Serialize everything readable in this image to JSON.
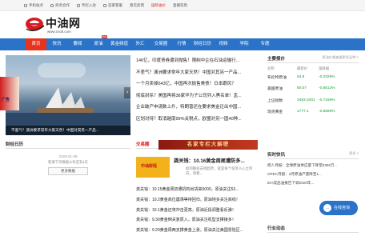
{
  "topbar": [
    "手机站点",
    "商务合作",
    "专栏入驻",
    "首家客服",
    "意见反馈",
    "国际油价",
    "直播签到"
  ],
  "logo": {
    "name": "中油网",
    "url": "www.cnoil.com"
  },
  "nav": {
    "items": [
      "首页",
      "快讯",
      "要闻",
      "原油",
      "黄金频道",
      "外汇",
      "交易圈",
      "行情",
      "财经日历",
      "视频",
      "学院",
      "专题"
    ],
    "hot_label": "Hot"
  },
  "slide": {
    "caption": "不差气？澳洲要求常年大家天然！中国对其另一产品..."
  },
  "left_banner": {
    "text": "广告"
  },
  "news": [
    "146亿，印度债券遭到抛售！限制中企在石油运输行...",
    "不差气？澳洲要求常年大家天然！中国对其另一产品...",
    "一个月卖掉643亿，中国再次抛售美债！日本跟风？",
    "彻底封杀？美国再将38家华为子公司列入黑名单！盂...",
    "企业破产申请数上升，特朗普还在要求美金迁出中国...",
    "区划对待？取消越南99%关税点，欧盟对另一国40种..."
  ],
  "market": {
    "title": "主要报价",
    "more": "原油价格查看更多品种 >",
    "head": [
      "名称",
      "最新价",
      "涨跌幅"
    ],
    "rows": [
      {
        "name": "布伦特原油",
        "price": "64.8",
        "change": "-0.2328%"
      },
      {
        "name": "美国原油",
        "price": "60.07",
        "change": "-0.6613%"
      },
      {
        "name": "上证指数",
        "price": "3483.3401",
        "change": "-0.7158%"
      },
      {
        "name": "现货黄金",
        "price": "1777.1",
        "change": "-0.5596%"
      }
    ]
  },
  "calendar": {
    "title": "财经日历",
    "date": "2020-01-09",
    "note": "距离下次数据公布还有4天",
    "button": "更多数据"
  },
  "jiaoyi": {
    "title": "交易圈",
    "ad_text": "名家专栏大解密"
  },
  "feature": {
    "logo": "中油财经",
    "title": "龚关钱：10.16黄金周尾遭防多...",
    "desc": "如何跟投去找趋势，就是每个投资人心之所向，请看..."
  },
  "news2": [
    "龚关钱：10.15黄金周初遭机构出货来5000，原油关注53...",
    "龚关钱：10.2黄金高位震荡等待回归，原油地多关注高线！",
    "龚关钱：10.1黄金还将冲击更高，原油近段调整看反弹！",
    "龚关钱：9.30黄金倒关复原入，原油关注机型支撑接多！",
    "龚关钱：9.29黄金周两支撑黄金上涨，原油关注美国冒险区..."
  ],
  "realtime": {
    "title": "实时快讯",
    "more": "更多 >",
    "items": [
      "把人月报：全球原油供应量下降至8380万...",
      "OPEC月报：3月原油产量降至1...",
      "EIA成品油报告下调2020年..."
    ]
  },
  "chat": {
    "label": "在线咨询"
  },
  "industry": {
    "title": "行业动态"
  }
}
